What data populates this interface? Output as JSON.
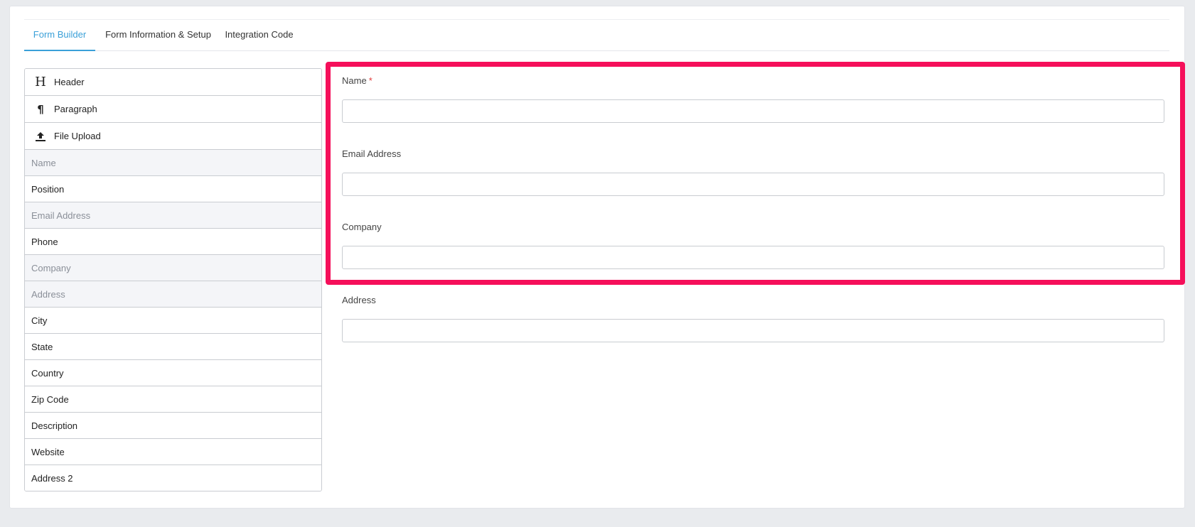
{
  "tabs": [
    {
      "label": "Form Builder",
      "active": true
    },
    {
      "label": "Form Information & Setup",
      "active": false
    },
    {
      "label": "Integration Code",
      "active": false
    }
  ],
  "tools": [
    {
      "label": "Header",
      "icon": "header-icon"
    },
    {
      "label": "Paragraph",
      "icon": "paragraph-icon"
    },
    {
      "label": "File Upload",
      "icon": "upload-icon"
    }
  ],
  "fields": [
    {
      "label": "Name",
      "disabled": true
    },
    {
      "label": "Position",
      "disabled": false
    },
    {
      "label": "Email Address",
      "disabled": true
    },
    {
      "label": "Phone",
      "disabled": false
    },
    {
      "label": "Company",
      "disabled": true
    },
    {
      "label": "Address",
      "disabled": true
    },
    {
      "label": "City",
      "disabled": false
    },
    {
      "label": "State",
      "disabled": false
    },
    {
      "label": "Country",
      "disabled": false
    },
    {
      "label": "Zip Code",
      "disabled": false
    },
    {
      "label": "Description",
      "disabled": false
    },
    {
      "label": "Website",
      "disabled": false
    },
    {
      "label": "Address 2",
      "disabled": false
    }
  ],
  "form": {
    "fields": [
      {
        "label": "Name",
        "required_mark": "*",
        "value": ""
      },
      {
        "label": "Email Address",
        "value": ""
      },
      {
        "label": "Company",
        "value": ""
      },
      {
        "label": "Address",
        "value": ""
      }
    ]
  },
  "colors": {
    "accent": "#3aa0d8",
    "highlight": "#f50f5a",
    "required": "#e23b3b",
    "page_bg": "#e9ebee"
  }
}
